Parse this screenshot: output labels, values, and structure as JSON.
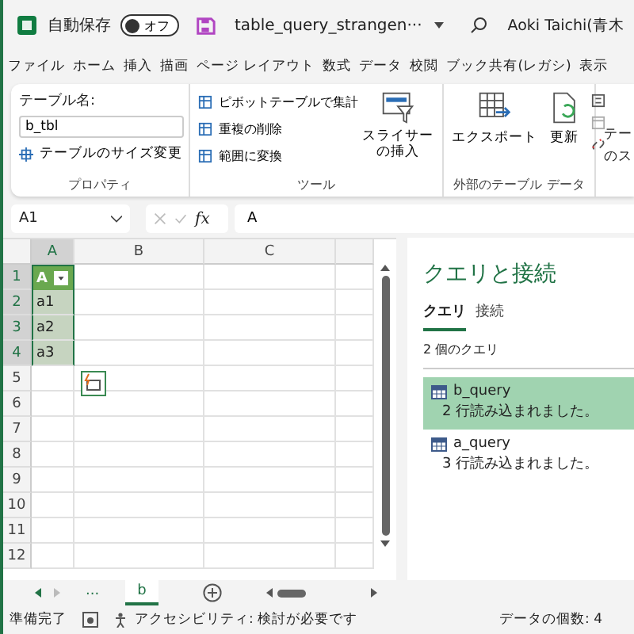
{
  "titlebar": {
    "autosave_label": "自動保存",
    "autosave_toggle": {
      "label": "オフ",
      "on": false
    },
    "filename": "table_query_strangen···",
    "user": "Aoki Taichi(青木"
  },
  "menu_tabs": [
    "ファイル",
    "ホーム",
    "挿入",
    "描画",
    "ページ レイアウト",
    "数式",
    "データ",
    "校閲",
    "ブック共有(レガシ)",
    "表示"
  ],
  "ribbon": {
    "properties": {
      "name_label": "テーブル名:",
      "name_value": "b_tbl",
      "resize_button": "テーブルのサイズ変更",
      "group_label": "プロパティ"
    },
    "tools": {
      "items": [
        "ピボットテーブルで集計",
        "重複の削除",
        "範囲に変換"
      ],
      "slicer_button": "スライサーの挿入",
      "group_label": "ツール"
    },
    "external": {
      "export_button": "エクスポート",
      "refresh_button": "更新",
      "group_label": "外部のテーブル データ"
    },
    "cut_group": {
      "line_1": "テー",
      "line_2": "のス"
    }
  },
  "formula_bar": {
    "name_box": "A1",
    "fx": "fx",
    "value": "A"
  },
  "sheet": {
    "columns": [
      "A",
      "B",
      "C"
    ],
    "rows": [
      "1",
      "2",
      "3",
      "4",
      "5",
      "6",
      "7",
      "8",
      "9",
      "10",
      "11",
      "12"
    ],
    "table": {
      "header": "A",
      "cells": [
        "a1",
        "a2",
        "a3"
      ]
    }
  },
  "queries_pane": {
    "title": "クエリと接続",
    "tabs": [
      {
        "label": "クエリ",
        "selected": true
      },
      {
        "label": "接続",
        "selected": false
      }
    ],
    "count": "2 個のクエリ",
    "queries": [
      {
        "name": "b_query",
        "status": "2 行読み込まれました。",
        "selected": true
      },
      {
        "name": "a_query",
        "status": "3 行読み込まれました。",
        "selected": false
      }
    ]
  },
  "sheet_tabs": [
    {
      "label": "...",
      "selected": false
    },
    {
      "label": "b",
      "selected": true
    }
  ],
  "status_bar": {
    "ready": "準備完了",
    "accessibility": "アクセシビリティ: 検討が必要です",
    "count": "データの個数: 4"
  }
}
